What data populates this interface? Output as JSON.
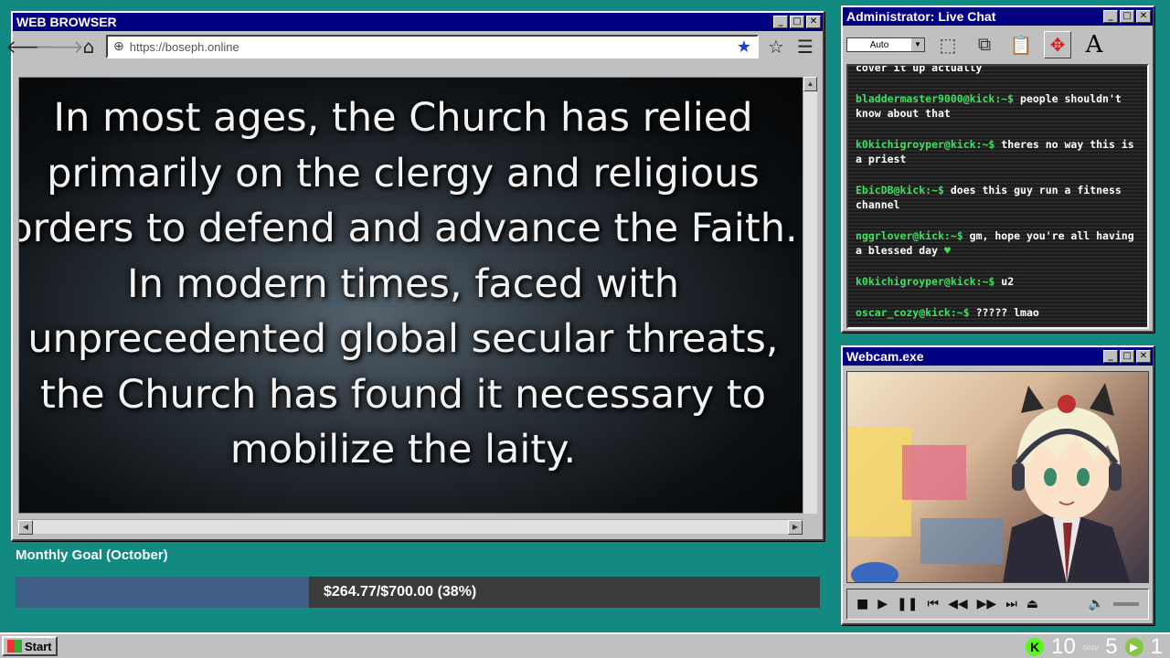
{
  "browser": {
    "title": "WEB BROWSER",
    "url": "https://boseph.online",
    "quote": "In most ages, the Church has relied primarily on the clergy and religious orders to defend and advance the Faith. In modern times, faced with unprecedented global secular threats, the Church has found it necessary to mobilize the laity."
  },
  "goal": {
    "label": "Monthly Goal (October)",
    "text": "$264.77/$700.00 (38%)",
    "progress": 0.38
  },
  "chat": {
    "title": "Administrator: Live Chat",
    "font_size_select": "Auto",
    "messages": [
      {
        "user": "",
        "text": "cover it up actually"
      },
      {
        "user": "bladdermaster9000@kick:~$",
        "text": "people shouldn't know about that"
      },
      {
        "user": "k0kichigroyper@kick:~$",
        "text": "theres no way this is a priest"
      },
      {
        "user": "EbicDB@kick:~$",
        "text": "does this guy run a fitness channel"
      },
      {
        "user": "nggrlover@kick:~$",
        "text": "gm, hope you're all having a blessed day"
      },
      {
        "user": "k0kichigroyper@kick:~$",
        "text": "u2"
      },
      {
        "user": "oscar_cozy@kick:~$",
        "text": "????? lmao"
      }
    ]
  },
  "webcam": {
    "title": "Webcam.exe"
  },
  "taskbar": {
    "start_label": "Start",
    "kick_count": "10",
    "cozy_label": "cozy",
    "cozy_count": "5",
    "rumble_count": "1"
  },
  "colors": {
    "desktop": "#128a82",
    "titlebar": "#000080",
    "chat_user": "#3fe060",
    "goal_fill": "#3e5e86"
  }
}
